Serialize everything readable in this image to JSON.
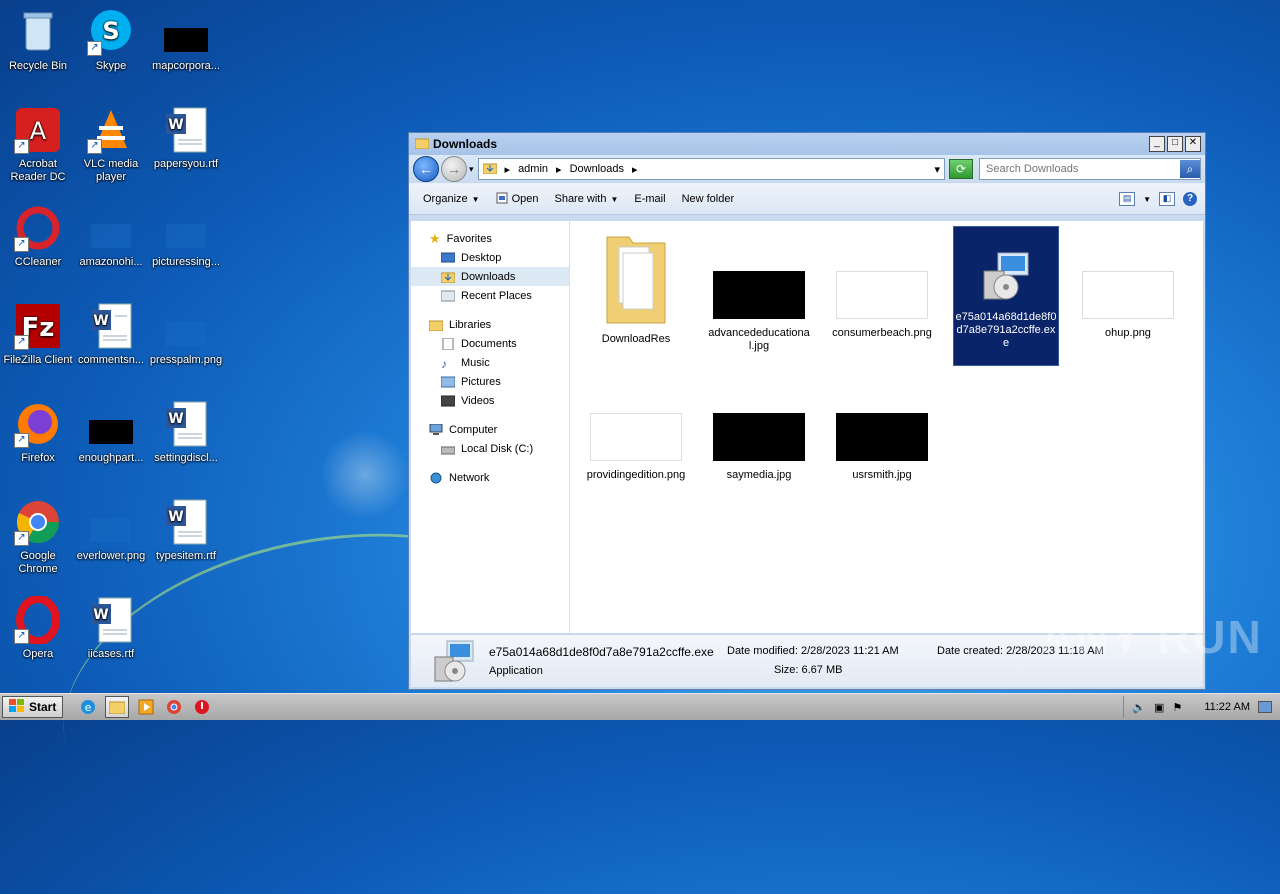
{
  "desktop": {
    "icons": [
      {
        "label": "Recycle Bin"
      },
      {
        "label": "Skype"
      },
      {
        "label": "mapcorpora..."
      },
      {
        "label": "Acrobat Reader DC"
      },
      {
        "label": "VLC media player"
      },
      {
        "label": "papersyou.rtf"
      },
      {
        "label": "CCleaner"
      },
      {
        "label": "amazonohi..."
      },
      {
        "label": "picturessing..."
      },
      {
        "label": "FileZilla Client"
      },
      {
        "label": "commentsn..."
      },
      {
        "label": "presspalm.png"
      },
      {
        "label": "Firefox"
      },
      {
        "label": "enoughpart..."
      },
      {
        "label": "settingdiscl..."
      },
      {
        "label": "Google Chrome"
      },
      {
        "label": "everlower.png"
      },
      {
        "label": "typesitem.rtf"
      },
      {
        "label": "Opera"
      },
      {
        "label": "iicases.rtf"
      }
    ]
  },
  "window": {
    "title": "Downloads",
    "breadcrumb": [
      "admin",
      "Downloads"
    ],
    "search_placeholder": "Search Downloads",
    "toolbar": {
      "organize": "Organize",
      "open": "Open",
      "share_with": "Share with",
      "email": "E-mail",
      "new_folder": "New folder"
    },
    "nav": {
      "favorites": "Favorites",
      "desktop": "Desktop",
      "downloads": "Downloads",
      "recent_places": "Recent Places",
      "libraries": "Libraries",
      "documents": "Documents",
      "music": "Music",
      "pictures": "Pictures",
      "videos": "Videos",
      "computer": "Computer",
      "local_disk": "Local Disk (C:)",
      "network": "Network"
    },
    "files": [
      {
        "name": "DownloadRes"
      },
      {
        "name": "advancededucational.jpg"
      },
      {
        "name": "consumerbeach.png"
      },
      {
        "name": "e75a014a68d1de8f0d7a8e791a2ccffe.exe"
      },
      {
        "name": "ohup.png"
      },
      {
        "name": "providingedition.png"
      },
      {
        "name": "saymedia.jpg"
      },
      {
        "name": "usrsmith.jpg"
      }
    ],
    "details": {
      "filename": "e75a014a68d1de8f0d7a8e791a2ccffe.exe",
      "type": "Application",
      "date_modified": "Date modified: 2/28/2023 11:21 AM",
      "size": "Size: 6.67 MB",
      "date_created": "Date created: 2/28/2023 11:18 AM"
    }
  },
  "taskbar": {
    "start": "Start",
    "clock": "11:22 AM"
  },
  "watermark": "ANY RUN"
}
